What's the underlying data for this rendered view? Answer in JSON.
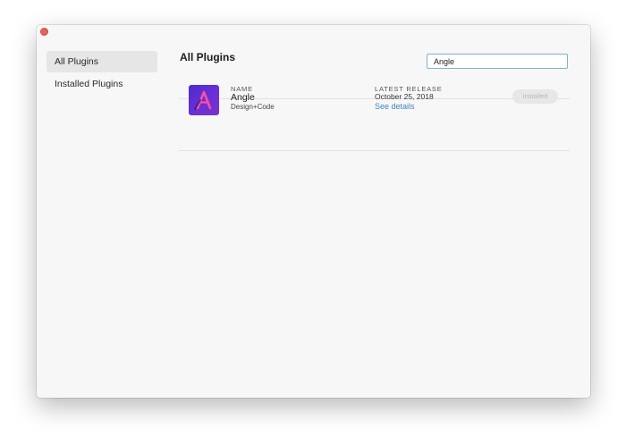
{
  "window": {
    "accent_color": "#7fb0d6",
    "close_button_color": "#e5635a"
  },
  "sidebar": {
    "items": [
      {
        "label": "All Plugins",
        "active": true
      },
      {
        "label": "Installed Plugins",
        "active": false
      }
    ]
  },
  "main": {
    "title": "All Plugins",
    "search": {
      "value": "Angle",
      "placeholder": ""
    },
    "columns": {
      "name": "NAME",
      "release": "LATEST RELEASE"
    },
    "plugins": [
      {
        "icon": "angle-logo-icon",
        "icon_letter": "A",
        "name": "Angle",
        "author": "Design+Code",
        "release_date": "October 25, 2018",
        "details_link": "See details",
        "status_label": "Installed",
        "link_color": "#3b86c4"
      }
    ]
  }
}
